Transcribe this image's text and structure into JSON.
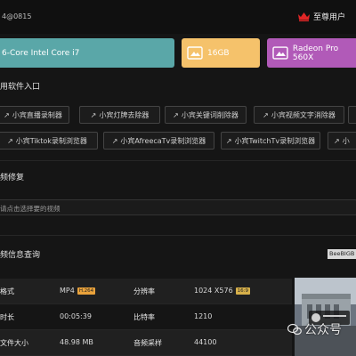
{
  "header": {
    "app_id": "4@0815",
    "vip_label": "至尊用户"
  },
  "hardware": {
    "cpu": "6-Core Intel Core i7",
    "ram": "16GB",
    "gpu": "Radeon Pro 560X"
  },
  "tools": {
    "title": "用软件入口",
    "row1": [
      "小宾直播录制器",
      "小宾灯牌去除器",
      "小宾关键词削除器",
      "小宾视频文字消除器"
    ],
    "row2": [
      "小宾Tiktok录制浏览器",
      "小宾AfreecaTv录制浏览器",
      "小宾TwitchTv录制浏览器",
      "小"
    ]
  },
  "repair": {
    "title": "频修复",
    "placeholder": "请点击选择要的视频"
  },
  "info": {
    "title": "频信息查询",
    "badge": "BeeBIGB",
    "rows": [
      {
        "k1": "格式",
        "v1": "MP4",
        "t1": "H.264",
        "k2": "分辨率",
        "v2": "1024 X576",
        "t2": "16:9"
      },
      {
        "k1": "时长",
        "v1": "00:05:39",
        "k2": "比特率",
        "v2": "1210"
      },
      {
        "k1": "文件大小",
        "v1": "48.98 MB",
        "k2": "音频采样",
        "v2": "44100"
      }
    ]
  },
  "watermark": "公众号",
  "colors": {
    "cpu": "#5aa7a8",
    "ram": "#f5c26b",
    "gpu": "#b15ab8",
    "tag": "#e9a23b",
    "crown": "#e02626"
  }
}
